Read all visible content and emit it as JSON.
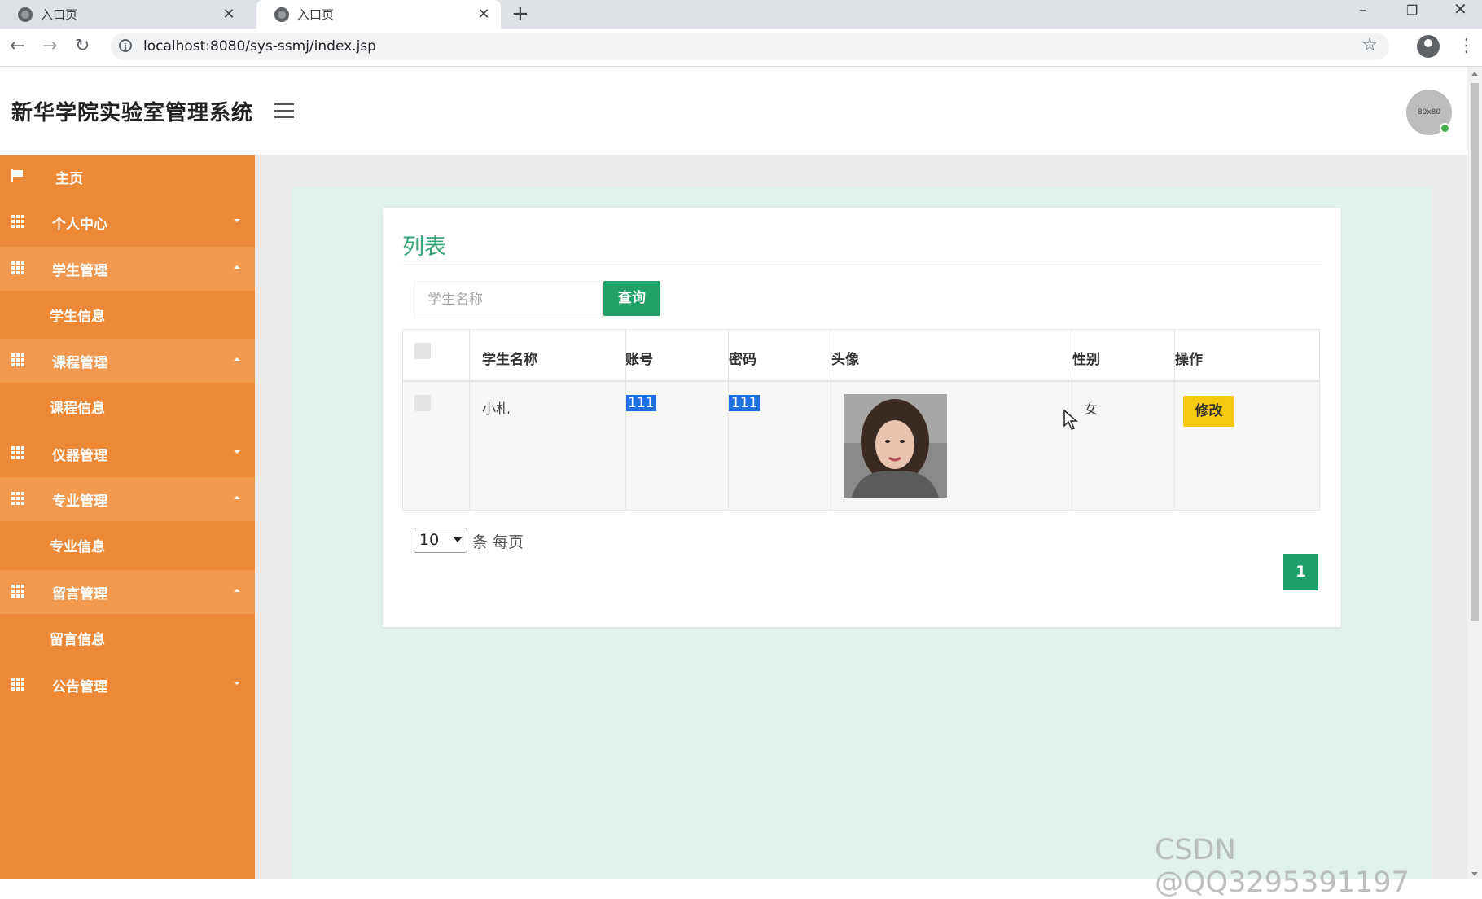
{
  "browser": {
    "tabs": [
      {
        "label": "入口页",
        "active": false
      },
      {
        "label": "入口页",
        "active": true
      }
    ],
    "new_tab_symbol": "+",
    "url": "localhost:8080/sys-ssmj/index.jsp"
  },
  "header": {
    "title": "新华学院实验室管理系统",
    "avatar_text": "80x80"
  },
  "sidebar": {
    "items": [
      {
        "label": "主页",
        "icon": "flag-icon",
        "expanded": null
      },
      {
        "label": "个人中心",
        "icon": "grid-icon",
        "expanded": false
      },
      {
        "label": "学生管理",
        "icon": "grid-icon",
        "expanded": true,
        "children": [
          "学生信息"
        ]
      },
      {
        "label": "课程管理",
        "icon": "grid-icon",
        "expanded": true,
        "children": [
          "课程信息"
        ]
      },
      {
        "label": "仪器管理",
        "icon": "grid-icon",
        "expanded": false
      },
      {
        "label": "专业管理",
        "icon": "grid-icon",
        "expanded": true,
        "children": [
          "专业信息"
        ]
      },
      {
        "label": "留言管理",
        "icon": "grid-icon",
        "expanded": true,
        "children": [
          "留言信息"
        ]
      },
      {
        "label": "公告管理",
        "icon": "grid-icon",
        "expanded": false
      }
    ],
    "sub_items": [
      "学生信息",
      "课程信息",
      "专业信息",
      "留言信息"
    ]
  },
  "main": {
    "card_title": "列表",
    "search": {
      "placeholder": "学生名称",
      "button_label": "查询"
    },
    "table": {
      "columns": [
        "学生名称",
        "账号",
        "密码",
        "头像",
        "性别",
        "操作"
      ],
      "rows": [
        {
          "name": "小札",
          "account": "111",
          "password": "111",
          "avatar": "photo",
          "gender": "女",
          "action_label": "修改"
        }
      ]
    },
    "pagination": {
      "page_size": "10",
      "per_page_label": "条 每页",
      "current_page": "1"
    }
  },
  "watermark": "CSDN @QQ3295391197",
  "colors": {
    "sidebar": "#ed8936",
    "accent_green": "#20a167",
    "edit_button": "#f6c90e",
    "content_bg": "#e3f1ee"
  }
}
